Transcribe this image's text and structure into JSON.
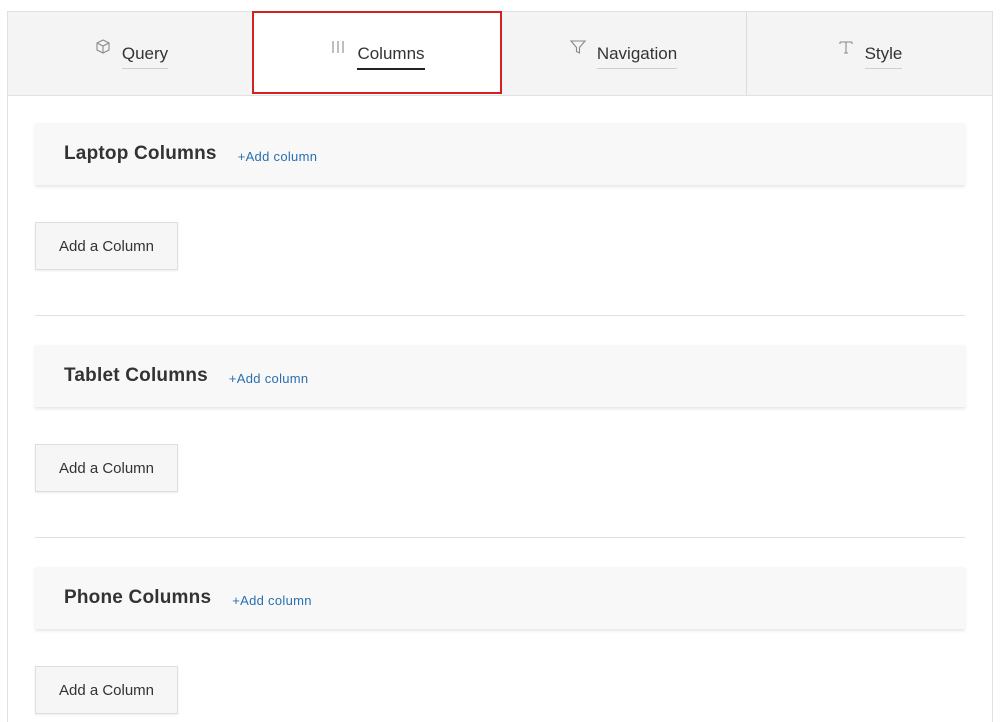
{
  "tabs": [
    {
      "label": "Query",
      "icon": "cube-icon"
    },
    {
      "label": "Columns",
      "icon": "columns-icon"
    },
    {
      "label": "Navigation",
      "icon": "filter-icon"
    },
    {
      "label": "Style",
      "icon": "text-icon"
    }
  ],
  "active_tab": "Columns",
  "sections": [
    {
      "title": "Laptop Columns",
      "add_link": "+Add column",
      "button": "Add a Column"
    },
    {
      "title": "Tablet Columns",
      "add_link": "+Add column",
      "button": "Add a Column"
    },
    {
      "title": "Phone Columns",
      "add_link": "+Add column",
      "button": "Add a Column"
    }
  ],
  "colors": {
    "accent_link": "#2a6fb0",
    "highlight": "#d32020"
  }
}
